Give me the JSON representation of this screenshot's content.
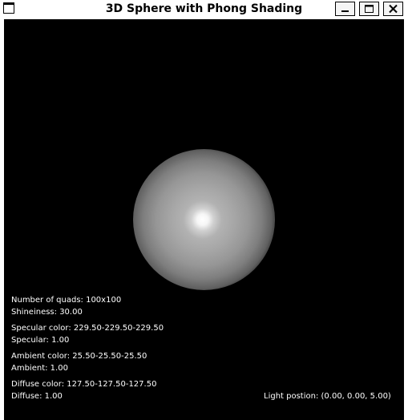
{
  "window": {
    "title": "3D Sphere with Phong Shading",
    "buttons": {
      "minimize": "minimize-icon",
      "maximize": "maximize-icon",
      "close": "close-icon"
    }
  },
  "scene": {
    "background_color": "#000000",
    "sphere_color": "#a0a0a0",
    "highlight_color": "#ffffff"
  },
  "info": {
    "quads": "Number of quads: 100x100",
    "shininess": "Shineiness: 30.00",
    "specular_color": "Specular color: 229.50-229.50-229.50",
    "specular": "Specular: 1.00",
    "ambient_color": "Ambient color: 25.50-25.50-25.50",
    "ambient": "Ambient: 1.00",
    "diffuse_color": "Diffuse color: 127.50-127.50-127.50",
    "diffuse": "Diffuse: 1.00",
    "light_position": "Light postion: (0.00, 0.00, 5.00)"
  }
}
